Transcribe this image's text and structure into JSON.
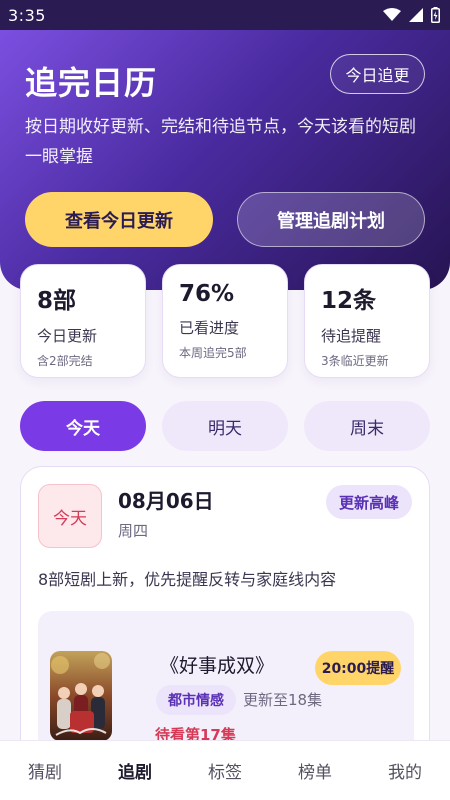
{
  "status_bar": {
    "time": "3:35"
  },
  "hero": {
    "title": "追完日历",
    "chip": "今日追更",
    "description": "按日期收好更新、完结和待追节点，今天该看的短剧一眼掌握",
    "primary_button": "查看今日更新",
    "secondary_button": "管理追剧计划"
  },
  "stats": [
    {
      "value": "8部",
      "label": "今日更新",
      "sub": "含2部完结"
    },
    {
      "value": "76%",
      "label": "已看进度",
      "sub": "本周追完5部"
    },
    {
      "value": "12条",
      "label": "待追提醒",
      "sub": "3条临近更新"
    }
  ],
  "tabs": [
    {
      "label": "今天",
      "active": true
    },
    {
      "label": "明天",
      "active": false
    },
    {
      "label": "周末",
      "active": false
    }
  ],
  "day_card": {
    "day_badge": "今天",
    "date": "08月06日",
    "weekday": "周四",
    "tag": "更新高峰",
    "summary": "8部短剧上新，优先提醒反转与家庭线内容"
  },
  "drama": {
    "title": "《好事成双》",
    "reminder": "20:00提醒",
    "genre": "都市情感",
    "episodes": "更新至18集",
    "pending": "待看第17集"
  },
  "bottom_nav": [
    {
      "label": "猜剧",
      "active": false
    },
    {
      "label": "追剧",
      "active": true
    },
    {
      "label": "标签",
      "active": false
    },
    {
      "label": "榜单",
      "active": false
    },
    {
      "label": "我的",
      "active": false
    }
  ],
  "colors": {
    "accent": "#7a3be6",
    "highlight": "#ffd56a",
    "alert": "#d63a56",
    "hero_dark": "#261452"
  }
}
